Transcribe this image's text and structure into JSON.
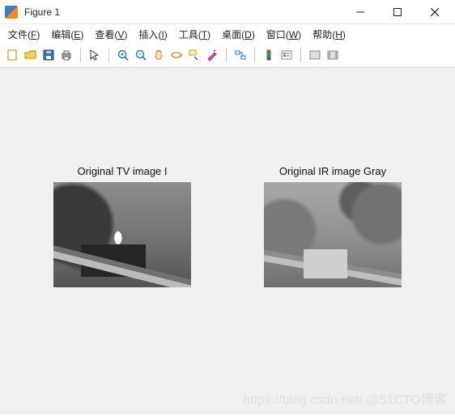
{
  "window": {
    "title": "Figure 1"
  },
  "menu": {
    "file": {
      "label": "文件",
      "key": "F"
    },
    "edit": {
      "label": "编辑",
      "key": "E"
    },
    "view": {
      "label": "查看",
      "key": "V"
    },
    "insert": {
      "label": "插入",
      "key": "I"
    },
    "tools": {
      "label": "工具",
      "key": "T"
    },
    "desktop": {
      "label": "桌面",
      "key": "D"
    },
    "window": {
      "label": "窗口",
      "key": "W"
    },
    "help": {
      "label": "帮助",
      "key": "H"
    }
  },
  "toolbar": {
    "new_figure": "new-figure",
    "open": "open",
    "save": "save",
    "print": "print",
    "pointer": "pointer",
    "zoom_in": "zoom-in",
    "zoom_out": "zoom-out",
    "pan": "pan",
    "rotate": "rotate-3d",
    "data_cursor": "data-cursor",
    "brush": "brush",
    "link": "link",
    "colorbar": "insert-colorbar",
    "legend": "insert-legend",
    "hide_tools": "hide-plot-tools",
    "show_tools": "show-plot-tools"
  },
  "figure": {
    "left": {
      "title": "Original TV image I"
    },
    "right": {
      "title": "Original IR image Gray"
    }
  },
  "watermark": "https://blog.csdn.net/  @51CTO博客"
}
